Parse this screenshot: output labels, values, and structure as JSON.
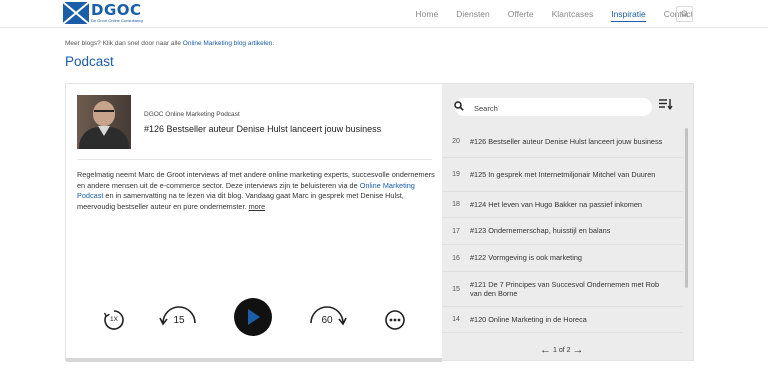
{
  "header": {
    "logo_name": "DGOC",
    "logo_sub": "De Groot Online Consultancy",
    "nav": [
      {
        "label": "Home"
      },
      {
        "label": "Diensten"
      },
      {
        "label": "Offerte"
      },
      {
        "label": "Klantcases"
      },
      {
        "label": "Inspiratie",
        "active": true
      },
      {
        "label": "Contact"
      }
    ]
  },
  "intro": {
    "text": "Meer blogs? Klik dan snel door naar alle",
    "link": "Online Marketing blog artikelen."
  },
  "page_title": "Podcast",
  "episode": {
    "show": "DGOC Online Marketing Podcast",
    "title": "#126 Bestseller auteur Denise Hulst lanceert jouw business",
    "desc_part1": "Regelmatig neemt Marc de Groot interviews af met andere online marketing experts, succesvolle ondernemers en andere mensen uit de e-commerce sector. Deze interviews zijn te beluisteren via de",
    "desc_link": "Online Marketing Podcast",
    "desc_part2": "en in samenvatting na te lezen via dit blog. Vandaag gaat Marc in gesprek met Denise Hulst, meervoudig bestseller auteur en pure ondernemster.",
    "more": "more"
  },
  "controls": {
    "speed": "1X",
    "rewind": "15",
    "forward": "60",
    "accent": "#1a5ea8"
  },
  "playlist": {
    "search_placeholder": "Search",
    "items": [
      {
        "num": "20",
        "title": "#126 Bestseller auteur Denise Hulst lanceert jouw business"
      },
      {
        "num": "19",
        "title": "#125 In gesprek met Internetmiljonair Mitchel van Duuren"
      },
      {
        "num": "18",
        "title": "#124 Het leven van Hugo Bakker na passief inkomen"
      },
      {
        "num": "17",
        "title": "#123 Ondernemerschap, huisstijl en balans"
      },
      {
        "num": "16",
        "title": "#122 Vormgeving is ook marketing"
      },
      {
        "num": "15",
        "title": "#121 De 7 Principes van Succesvol Ondernemen met Rob van den Borne"
      },
      {
        "num": "14",
        "title": "#120 Online Marketing in de Horeca"
      }
    ],
    "pager": "1 of 2"
  }
}
